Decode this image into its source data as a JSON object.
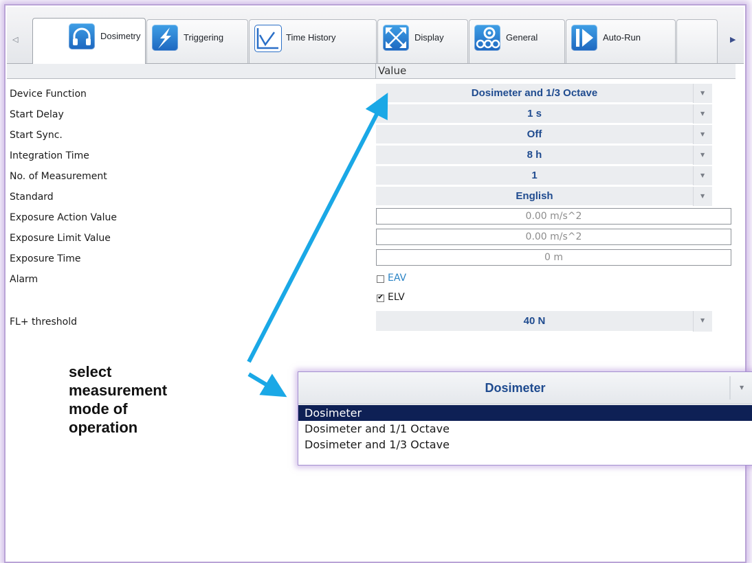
{
  "tabs": [
    {
      "label": "Dosimetry",
      "icon": "headphones-icon",
      "active": true
    },
    {
      "label": "Triggering",
      "icon": "lightning-icon",
      "active": false
    },
    {
      "label": "Time History",
      "icon": "chart-line-icon",
      "active": false
    },
    {
      "label": "Display",
      "icon": "expand-arrows-icon",
      "active": false
    },
    {
      "label": "General",
      "icon": "gears-icon",
      "active": false
    },
    {
      "label": "Auto-Run",
      "icon": "play-icon",
      "active": false
    }
  ],
  "grid": {
    "column_header": "Value",
    "rows": [
      {
        "label": "Device Function",
        "value": "Dosimeter and 1/3 Octave"
      },
      {
        "label": "Start Delay",
        "value": "1 s"
      },
      {
        "label": "Start Sync.",
        "value": "Off"
      },
      {
        "label": "Integration Time",
        "value": "8 h"
      },
      {
        "label": "No. of Measurement",
        "value": "1"
      },
      {
        "label": "Standard",
        "value": "English"
      },
      {
        "label": "Exposure Action Value",
        "value": "0.00 m/s^2"
      },
      {
        "label": "Exposure Limit Value",
        "value": "0.00 m/s^2"
      },
      {
        "label": "Exposure Time",
        "value": "0 m"
      },
      {
        "label": "Alarm"
      },
      {
        "label": "FL+ threshold",
        "value": "40 N"
      }
    ],
    "alarm": {
      "eav_label": "EAV",
      "eav_checked": false,
      "eav_color": "#2a83c5",
      "elv_label": "ELV",
      "elv_checked": true
    }
  },
  "annotation": {
    "lines": [
      "select",
      "measurement",
      "mode of",
      "operation"
    ],
    "arrow_color": "#1aa8e6"
  },
  "popup": {
    "value": "Dosimeter",
    "options": [
      "Dosimeter",
      "Dosimeter and 1/1 Octave",
      "Dosimeter and 1/3 Octave"
    ],
    "selected": "Dosimeter",
    "highlight_color": "#0e2055"
  }
}
